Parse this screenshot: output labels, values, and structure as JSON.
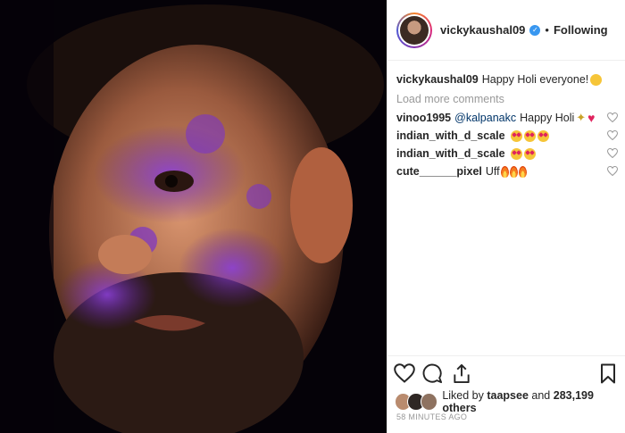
{
  "header": {
    "username": "vickykaushal09",
    "separator": "•",
    "follow_status": "Following",
    "verified_icon": "verified-badge-icon"
  },
  "caption": {
    "username": "vickykaushal09",
    "text": "Happy Holi everyone!"
  },
  "load_more": "Load more comments",
  "comments": [
    {
      "username": "vinoo1995",
      "mention": "@kalpanakc",
      "text": "Happy Holi"
    },
    {
      "username": "indian_with_d_scale",
      "text": ""
    },
    {
      "username": "indian_with_d_scale",
      "text": ""
    },
    {
      "username": "cute______pixel",
      "text": "Uff"
    }
  ],
  "likes": {
    "prefix": "Liked by",
    "liker": "taapsee",
    "middle": "and",
    "count": "283,199 others"
  },
  "timestamp": "58 MINUTES AGO",
  "colors": {
    "link": "#003569",
    "verified": "#3897f0",
    "meta": "#999999"
  }
}
